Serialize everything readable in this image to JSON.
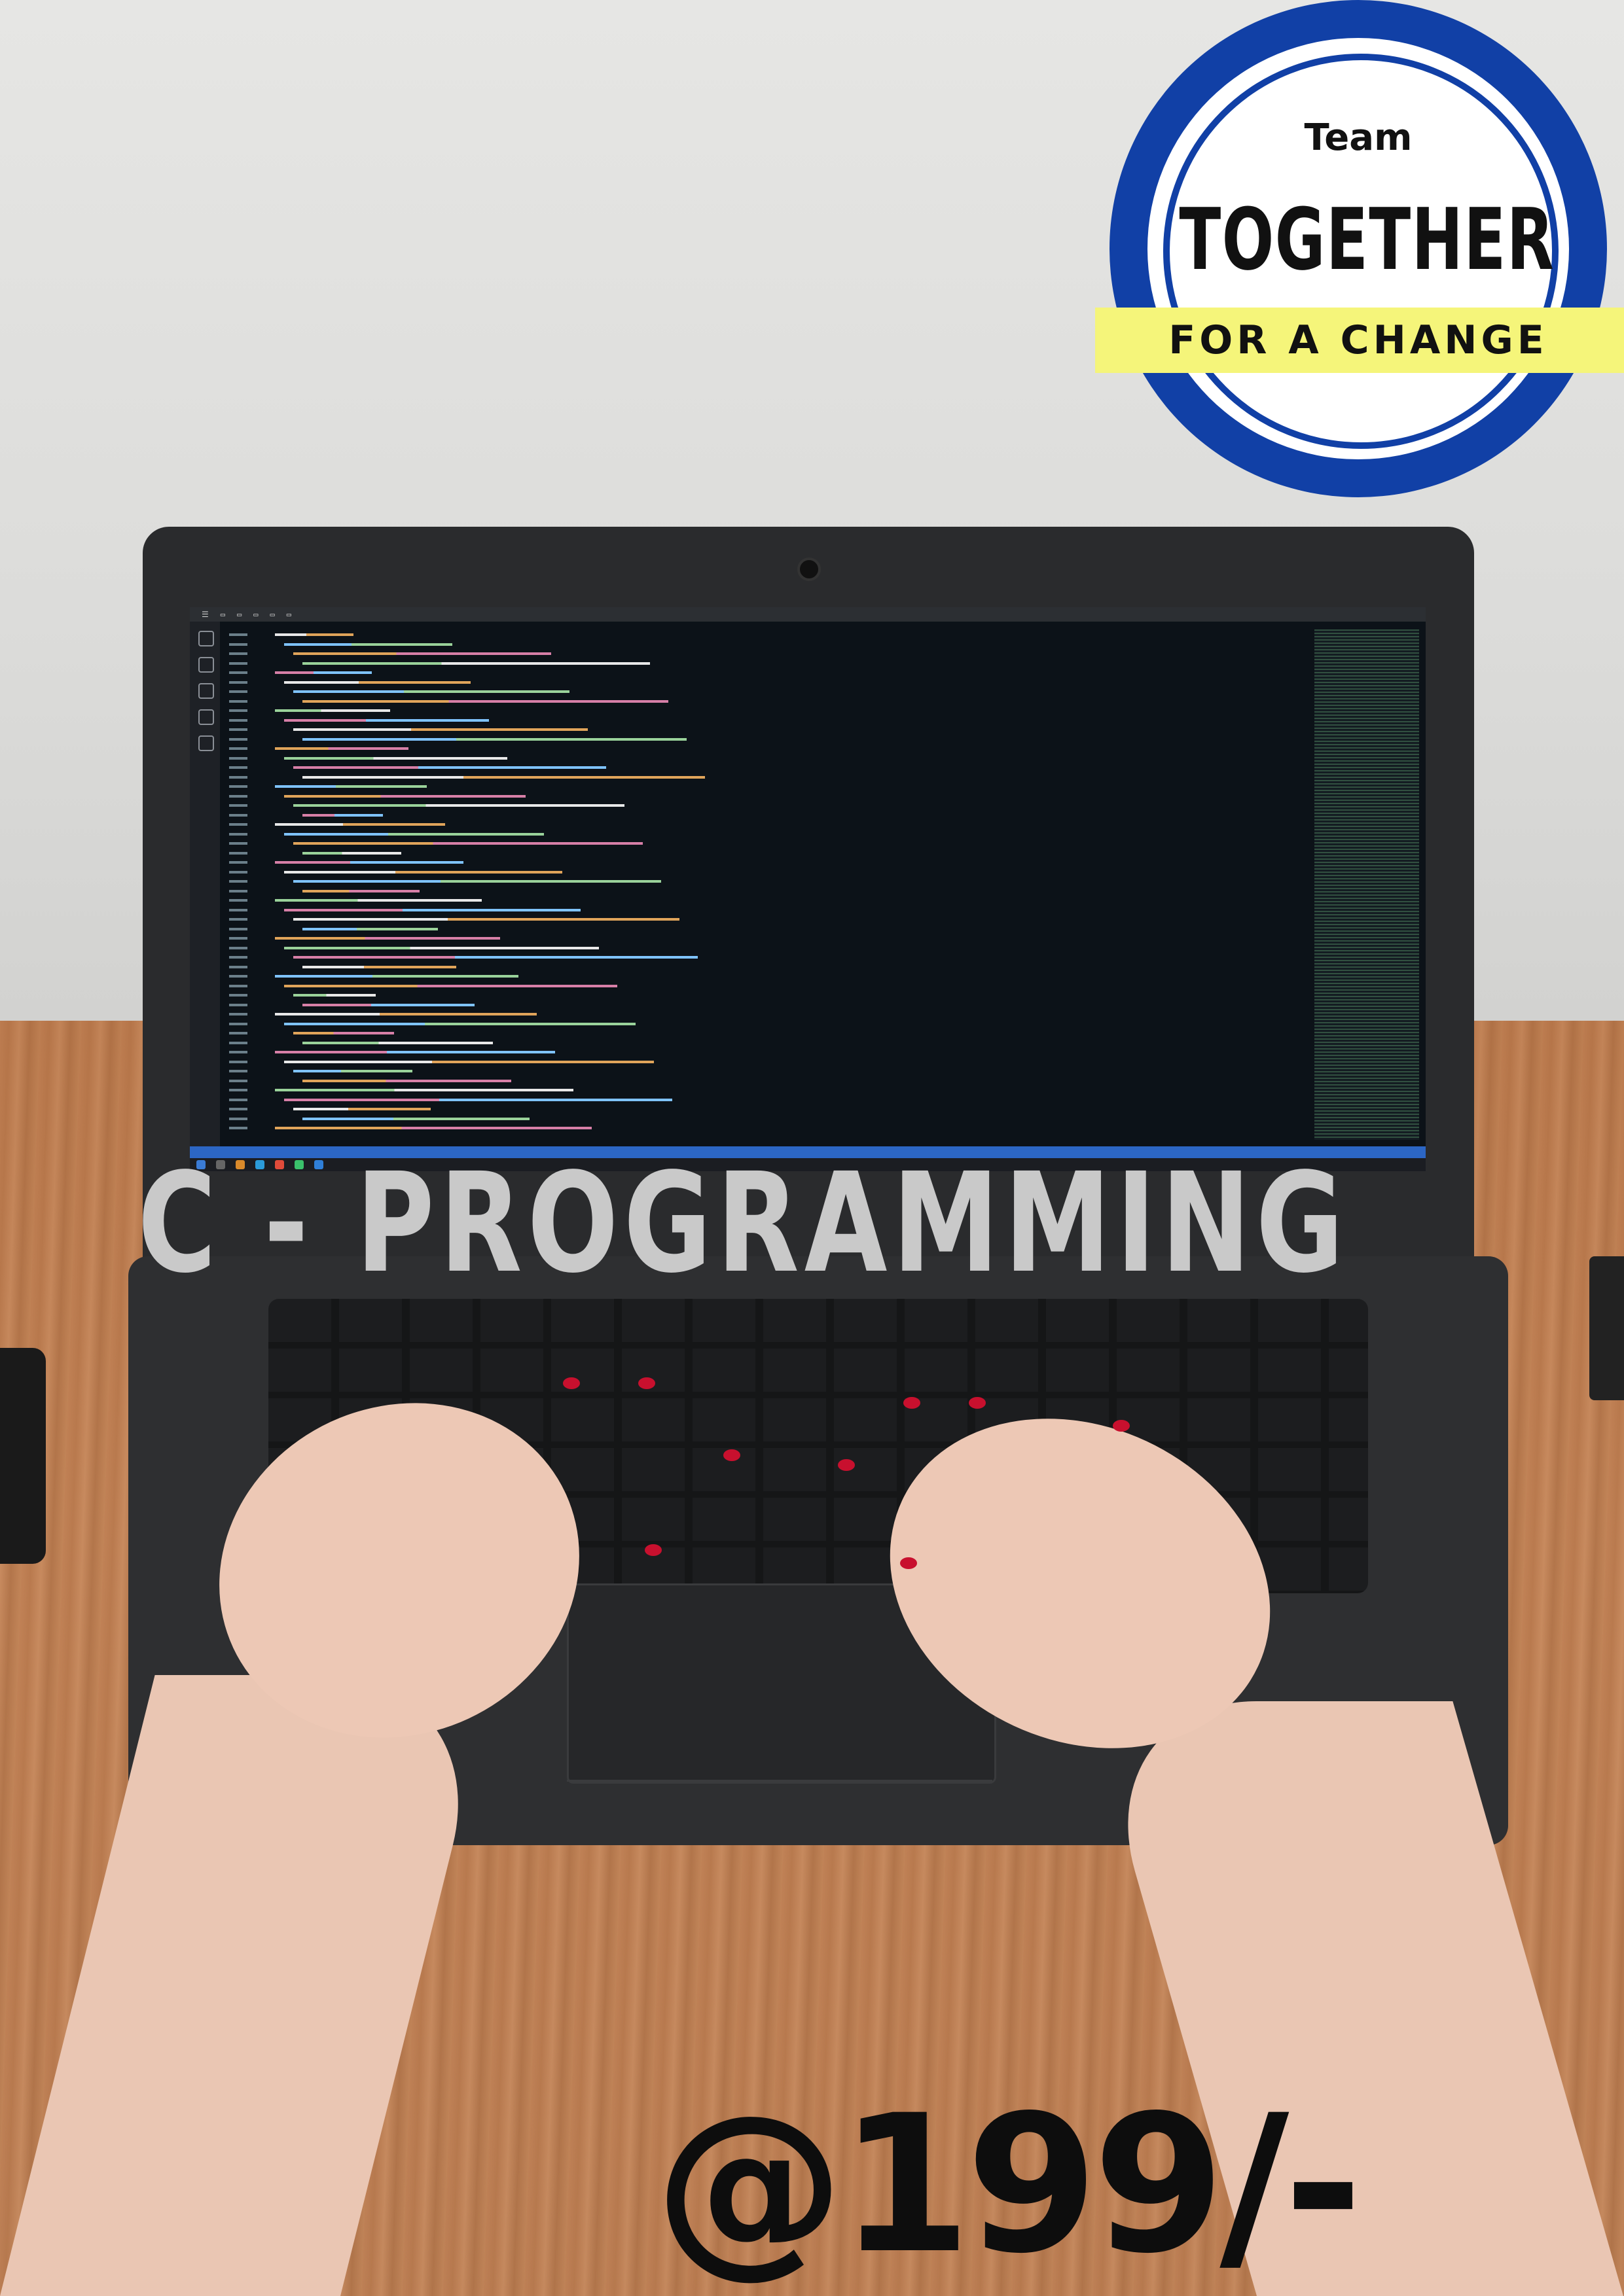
{
  "badge": {
    "team": "Team",
    "together": "TOGETHER",
    "tagline": "FOR A CHANGE",
    "colors": {
      "ring": "#1140a6",
      "band": "#f5f57a"
    }
  },
  "headline": "C - PROGRAMMING",
  "price": "@199/-"
}
